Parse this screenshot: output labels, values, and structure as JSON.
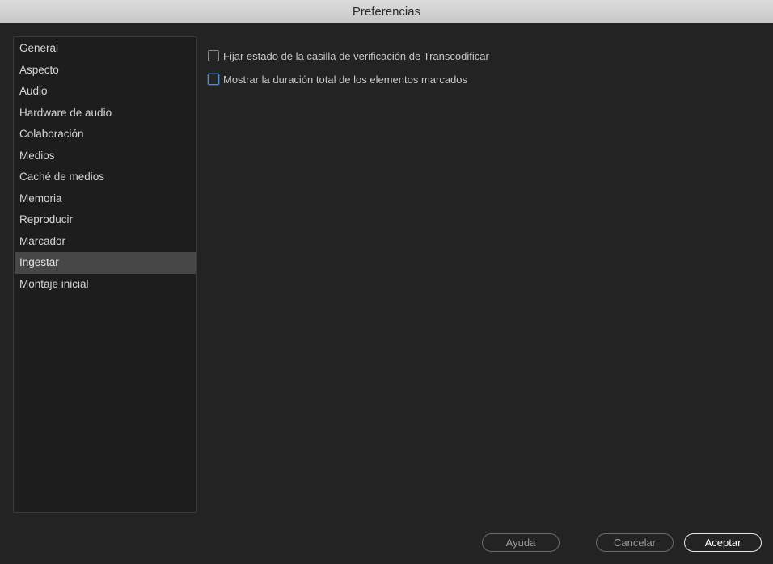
{
  "window": {
    "title": "Preferencias"
  },
  "sidebar": {
    "items": [
      {
        "label": "General",
        "selected": false
      },
      {
        "label": "Aspecto",
        "selected": false
      },
      {
        "label": "Audio",
        "selected": false
      },
      {
        "label": "Hardware de audio",
        "selected": false
      },
      {
        "label": "Colaboración",
        "selected": false
      },
      {
        "label": "Medios",
        "selected": false
      },
      {
        "label": "Caché de medios",
        "selected": false
      },
      {
        "label": "Memoria",
        "selected": false
      },
      {
        "label": "Reproducir",
        "selected": false
      },
      {
        "label": "Marcador",
        "selected": false
      },
      {
        "label": "Ingestar",
        "selected": true
      },
      {
        "label": "Montaje inicial",
        "selected": false
      }
    ]
  },
  "options": [
    {
      "label": "Fijar estado de la casilla de verificación de Transcodificar",
      "checked": false,
      "focused": false
    },
    {
      "label": "Mostrar la duración total de los elementos marcados",
      "checked": false,
      "focused": true
    }
  ],
  "footer": {
    "help_label": "Ayuda",
    "cancel_label": "Cancelar",
    "ok_label": "Aceptar"
  },
  "colors": {
    "background": "#232323",
    "selected_item": "#474747",
    "focus_accent": "#4a8ee2"
  }
}
